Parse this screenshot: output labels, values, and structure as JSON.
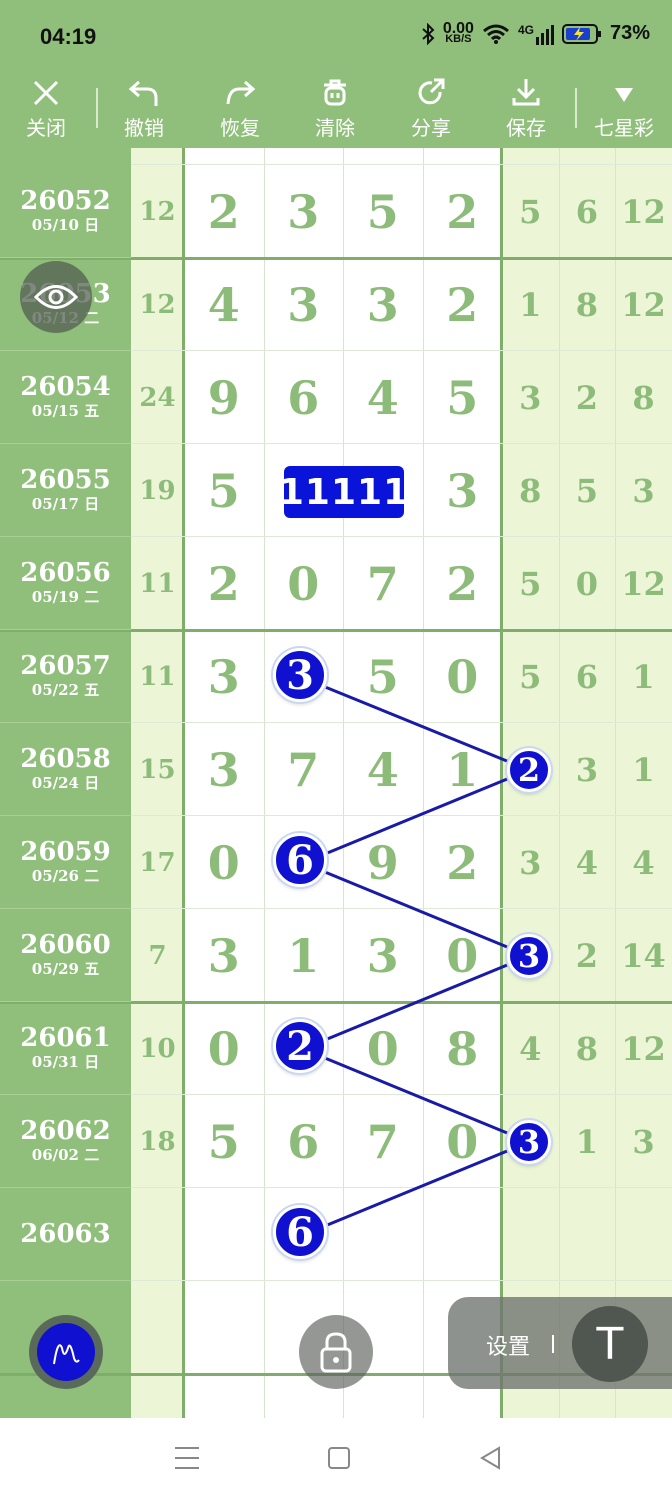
{
  "status": {
    "time": "04:19",
    "net_speed": "0.00",
    "net_unit": "KB/S",
    "network": "4G",
    "battery": "73%"
  },
  "toolbar": [
    {
      "label": "关闭",
      "icon": "close-icon"
    },
    {
      "label": "撤销",
      "icon": "undo-icon"
    },
    {
      "label": "恢复",
      "icon": "redo-icon"
    },
    {
      "label": "清除",
      "icon": "trash-icon"
    },
    {
      "label": "分享",
      "icon": "share-icon"
    },
    {
      "label": "保存",
      "icon": "download-icon"
    },
    {
      "label": "七星彩",
      "icon": "triangle-down-icon"
    }
  ],
  "rows": [
    {
      "issue": "26052",
      "date": "05/10 日",
      "sum": "12",
      "main": [
        "2",
        "3",
        "5",
        "2"
      ],
      "right": [
        "5",
        "6",
        "12"
      ]
    },
    {
      "issue": "26053",
      "date": "05/12 二",
      "sum": "12",
      "main": [
        "4",
        "3",
        "3",
        "2"
      ],
      "right": [
        "1",
        "8",
        "12"
      ]
    },
    {
      "issue": "26054",
      "date": "05/15 五",
      "sum": "24",
      "main": [
        "9",
        "6",
        "4",
        "5"
      ],
      "right": [
        "3",
        "2",
        "8"
      ]
    },
    {
      "issue": "26055",
      "date": "05/17 日",
      "sum": "19",
      "main": [
        "5",
        "",
        "",
        "3"
      ],
      "right": [
        "8",
        "5",
        "3"
      ]
    },
    {
      "issue": "26056",
      "date": "05/19 二",
      "sum": "11",
      "main": [
        "2",
        "0",
        "7",
        "2"
      ],
      "right": [
        "5",
        "0",
        "12"
      ]
    },
    {
      "issue": "26057",
      "date": "05/22 五",
      "sum": "11",
      "main": [
        "3",
        "",
        "5",
        "0"
      ],
      "right": [
        "5",
        "6",
        "1"
      ]
    },
    {
      "issue": "26058",
      "date": "05/24 日",
      "sum": "15",
      "main": [
        "3",
        "7",
        "4",
        "1"
      ],
      "right": [
        "",
        "3",
        "1"
      ]
    },
    {
      "issue": "26059",
      "date": "05/26 二",
      "sum": "17",
      "main": [
        "0",
        "",
        "9",
        "2"
      ],
      "right": [
        "3",
        "4",
        "4"
      ]
    },
    {
      "issue": "26060",
      "date": "05/29 五",
      "sum": "7",
      "main": [
        "3",
        "1",
        "3",
        "0"
      ],
      "right": [
        "",
        "2",
        "14"
      ]
    },
    {
      "issue": "26061",
      "date": "05/31 日",
      "sum": "10",
      "main": [
        "0",
        "",
        "0",
        "8"
      ],
      "right": [
        "4",
        "8",
        "12"
      ]
    },
    {
      "issue": "26062",
      "date": "06/02 二",
      "sum": "18",
      "main": [
        "5",
        "6",
        "7",
        "0"
      ],
      "right": [
        "",
        "1",
        "3"
      ]
    },
    {
      "issue": "26063",
      "date": "",
      "sum": "",
      "main": [
        "",
        "",
        "",
        ""
      ],
      "right": [
        "",
        "",
        ""
      ]
    }
  ],
  "badge": "11111",
  "balls": [
    "3",
    "2",
    "6",
    "3",
    "2",
    "3",
    "6"
  ],
  "settings_label": "设置",
  "t_button": "T",
  "colors": {
    "accent_green": "#8fbf7b",
    "ball_blue": "#1010d0",
    "pale": "#ecf5d6"
  }
}
